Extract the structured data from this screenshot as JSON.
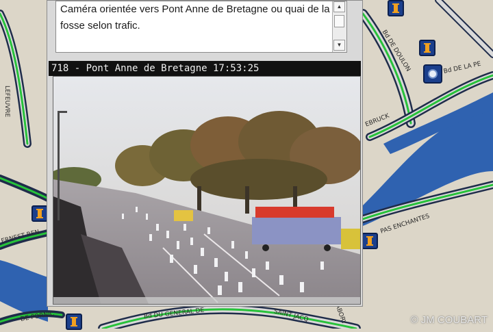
{
  "map": {
    "street_labels": [
      {
        "id": "bd-de-doulon",
        "text": "Bd DE DOULON"
      },
      {
        "id": "bd-de-la-pe",
        "text": "Bd DE LA PE"
      },
      {
        "id": "ebruck",
        "text": "EBRUCK"
      },
      {
        "id": "pas-enchantes",
        "text": "PAS ENCHANTES"
      },
      {
        "id": "ernest-ren",
        "text": "ERNEST REN"
      },
      {
        "id": "de-pornic",
        "text": "DE PORNIC"
      },
      {
        "id": "bd-du-general",
        "text": "Bd DU GENERAL DE"
      },
      {
        "id": "saint-jacq",
        "text": "SAINT JACQ"
      },
      {
        "id": "abory",
        "text": "ABORY"
      },
      {
        "id": "rue-left",
        "text": "LEFEUVRE"
      }
    ],
    "colors": {
      "background": "#dcd6c8",
      "river": "#2f62b0",
      "road_green": "#27c23a",
      "road_outline": "#1f2c4a",
      "road_fill": "#d9d9d9",
      "camera_icon": "#1b3f8c"
    }
  },
  "popup": {
    "description": "Caméra orientée vers Pont  Anne de Bretagne ou quai de la fosse selon trafic.",
    "caption": "718 - Pont Anne de Bretagne 17:53:25",
    "scroll_up_icon": "triangle-up-icon",
    "scroll_down_icon": "triangle-down-icon"
  },
  "watermark": "© JM COUBART"
}
